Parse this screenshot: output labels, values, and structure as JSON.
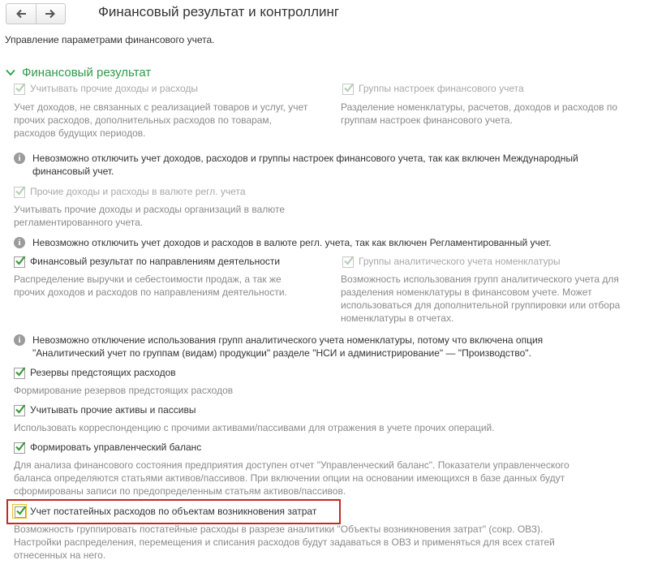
{
  "header": {
    "title": "Финансовый результат и контроллинг",
    "subtitle": "Управление параметрами финансового учета."
  },
  "section": {
    "title": "Финансовый результат"
  },
  "options": {
    "other_income": {
      "label": "Учитывать прочие доходы и расходы",
      "checked": true,
      "enabled": false,
      "desc": [
        "Учет доходов, не связанных с реализацией товаров и услуг, учет",
        "прочих расходов, дополнительных расходов по товарам,",
        "расходов будущих периодов."
      ]
    },
    "settings_groups": {
      "label": "Группы настроек финансового учета",
      "checked": true,
      "enabled": false,
      "desc": [
        "Разделение номенклатуры, расчетов, доходов и расходов по",
        "группам настроек финансового учета."
      ]
    },
    "info_1": [
      "Невозможно отключить учет доходов, расходов и группы настроек финансового учета, так как включен Международный",
      "финансовый учет."
    ],
    "currency_income": {
      "label": "Прочие доходы и расходы в валюте регл. учета",
      "checked": true,
      "enabled": false,
      "desc": [
        "Учитывать прочие доходы и расходы организаций в валюте",
        "регламентированного учета."
      ]
    },
    "info_2": [
      "Невозможно отключить учет доходов и расходов в валюте регл. учета, так как включен Регламентированный учет."
    ],
    "activities": {
      "label": "Финансовый результат по направлениям деятельности",
      "checked": true,
      "enabled": true,
      "desc": [
        "Распределение выручки и себестоимости продаж, а так же",
        "прочих доходов и расходов по направлениям деятельности."
      ]
    },
    "analytic_groups": {
      "label": "Группы аналитического учета номенклатуры",
      "checked": true,
      "enabled": false,
      "desc": [
        "Возможность использования групп аналитического учета для",
        "разделения номенклатуры в финансовом учете. Может",
        "использоваться для дополнительной группировки или отбора",
        "номенклатуры в отчетах."
      ]
    },
    "info_3": [
      "Невозможно отключение использования групп аналитического учета номенклатуры, потому что включена опция",
      "\"Аналитический учет по группам (видам) продукции\" разделе \"НСИ и администрирование\" — \"Производство\"."
    ],
    "reserves": {
      "label": "Резервы предстоящих расходов",
      "checked": true,
      "enabled": true,
      "desc": [
        "Формирование резервов предстоящих расходов"
      ]
    },
    "other_assets": {
      "label": "Учитывать прочие активы и пассивы",
      "checked": true,
      "enabled": true,
      "desc": [
        "Использовать корреспонденцию с прочими активами/пассивами для отражения в учете прочих операций."
      ]
    },
    "mgmt_balance": {
      "label": "Формировать управленческий баланс",
      "checked": true,
      "enabled": true,
      "desc": [
        "Для анализа финансового состояния предприятия доступен отчет \"Управленческий баланс\". Показатели управленческого",
        "баланса определяются статьями активов/пассивов. При включении опции на основании имеющихся в базе данных будут",
        "сформированы записи по предопределенным статьям активов/пассивов."
      ]
    },
    "cost_objects": {
      "label": "Учет постатейных расходов по объектам возникновения затрат",
      "checked": true,
      "enabled": true,
      "desc": [
        "Возможность группировать постатейные расходы в разрезе аналитики \"Объекты возникновения затрат\" (сокр. ОВЗ).",
        "Настройки распределения, перемещения и списания расходов будут задаваться в ОВЗ и применяться для всех статей",
        "отнесенных на него."
      ]
    }
  },
  "colors": {
    "accent_green": "#2f9a4a",
    "check_green": "#3a9a3a",
    "highlight_red": "#c02a2a"
  }
}
